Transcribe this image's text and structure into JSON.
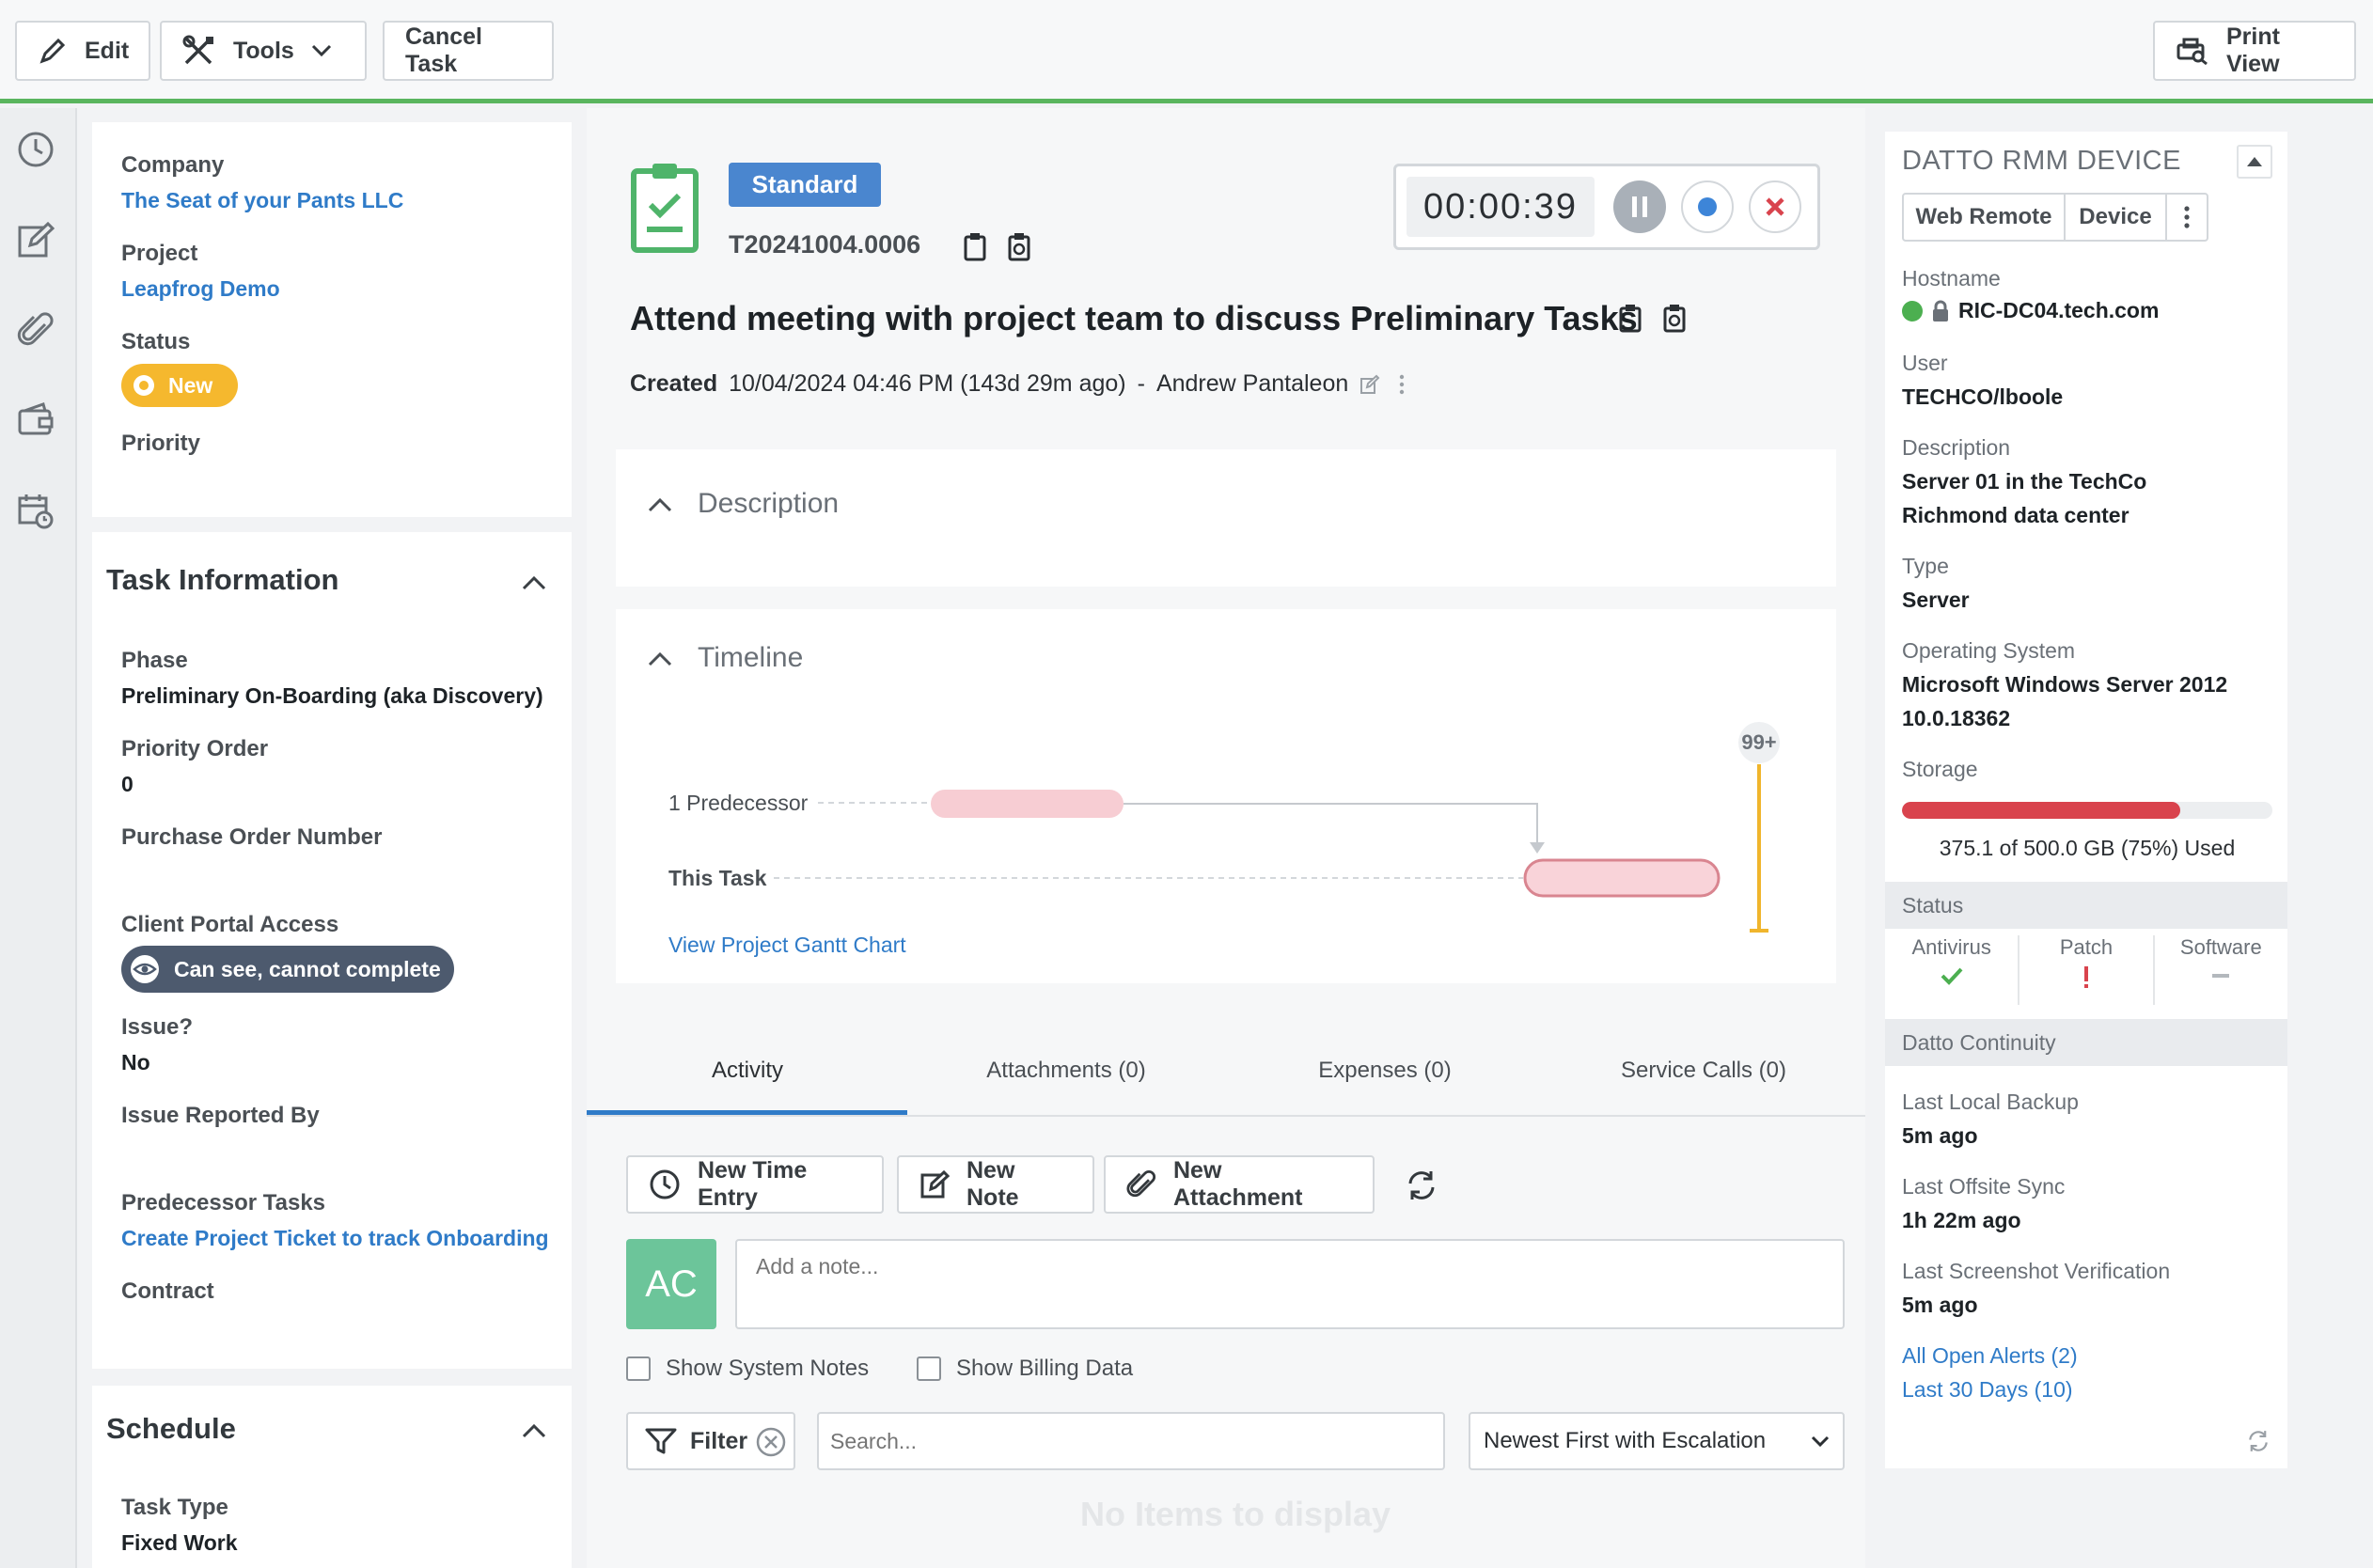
{
  "toolbar": {
    "edit": "Edit",
    "tools": "Tools",
    "cancel_task": "Cancel Task",
    "print_view": "Print View"
  },
  "left": {
    "company_label": "Company",
    "company_value": "The Seat of your Pants LLC",
    "project_label": "Project",
    "project_value": "Leapfrog Demo",
    "status_label": "Status",
    "status_value": "New",
    "priority_label": "Priority",
    "task_info": {
      "title": "Task Information",
      "phase_label": "Phase",
      "phase_value": "Preliminary On-Boarding (aka Discovery)",
      "priority_order_label": "Priority Order",
      "priority_order_value": "0",
      "po_label": "Purchase Order Number",
      "portal_label": "Client Portal Access",
      "portal_value": "Can see, cannot complete",
      "issue_label": "Issue?",
      "issue_value": "No",
      "issue_reported_label": "Issue Reported By",
      "predecessor_label": "Predecessor Tasks",
      "predecessor_value": "Create Project Ticket to track Onboarding",
      "contract_label": "Contract"
    },
    "schedule": {
      "title": "Schedule",
      "task_type_label": "Task Type",
      "task_type_value": "Fixed Work"
    }
  },
  "task": {
    "badge": "Standard",
    "number": "T20241004.0006",
    "title": "Attend meeting with project team to discuss Preliminary Tasks",
    "created_label": "Created",
    "created_value": "10/04/2024 04:46 PM (143d 29m ago)",
    "separator": "-",
    "created_by": "Andrew Pantaleon",
    "timer": "00:00:39"
  },
  "description": {
    "title": "Description"
  },
  "timeline": {
    "title": "Timeline",
    "predecessor_row": "1 Predecessor",
    "task_row": "This Task",
    "badge": "99+",
    "gantt_link": "View Project Gantt Chart"
  },
  "tabs": [
    {
      "label": "Activity",
      "active": true
    },
    {
      "label": "Attachments (0)",
      "active": false
    },
    {
      "label": "Expenses (0)",
      "active": false
    },
    {
      "label": "Service Calls (0)",
      "active": false
    }
  ],
  "activity": {
    "new_time_entry": "New Time Entry",
    "new_note": "New Note",
    "new_attachment": "New Attachment",
    "avatar_initials": "AC",
    "note_placeholder": "Add a note...",
    "show_system_notes": "Show System Notes",
    "show_billing_data": "Show Billing Data",
    "filter": "Filter",
    "search_placeholder": "Search...",
    "sort_value": "Newest First with Escalation",
    "empty": "No Items to display"
  },
  "rmm": {
    "title": "DATTO RMM DEVICE",
    "web_remote": "Web Remote",
    "device": "Device",
    "hostname_label": "Hostname",
    "hostname_value": "RIC-DC04.tech.com",
    "user_label": "User",
    "user_value": "TECHCO/lboole",
    "description_label": "Description",
    "description_line1": "Server 01 in the TechCo",
    "description_line2": "Richmond data center",
    "type_label": "Type",
    "type_value": "Server",
    "os_label": "Operating System",
    "os_line1": "Microsoft Windows Server 2012",
    "os_line2": "10.0.18362",
    "storage_label": "Storage",
    "storage_used_fraction": 0.75,
    "storage_text": "375.1 of 500.0 GB (75%) Used",
    "status_header": "Status",
    "antivirus": "Antivirus",
    "patch": "Patch",
    "software": "Software",
    "continuity_header": "Datto Continuity",
    "last_local_backup_label": "Last Local Backup",
    "last_local_backup_value": "5m ago",
    "last_offsite_label": "Last Offsite Sync",
    "last_offsite_value": "1h 22m ago",
    "last_screenshot_label": "Last Screenshot Verification",
    "last_screenshot_value": "5m ago",
    "all_alerts": "All Open Alerts (2)",
    "last_30_days": "Last 30 Days (10)"
  },
  "colors": {
    "accent_green": "#5ab55e",
    "link_blue": "#2f7bc8",
    "badge_blue": "#4a86cf",
    "status_yellow": "#f5b82e",
    "storage_red": "#d9434d",
    "avatar_green": "#6cc59a"
  }
}
